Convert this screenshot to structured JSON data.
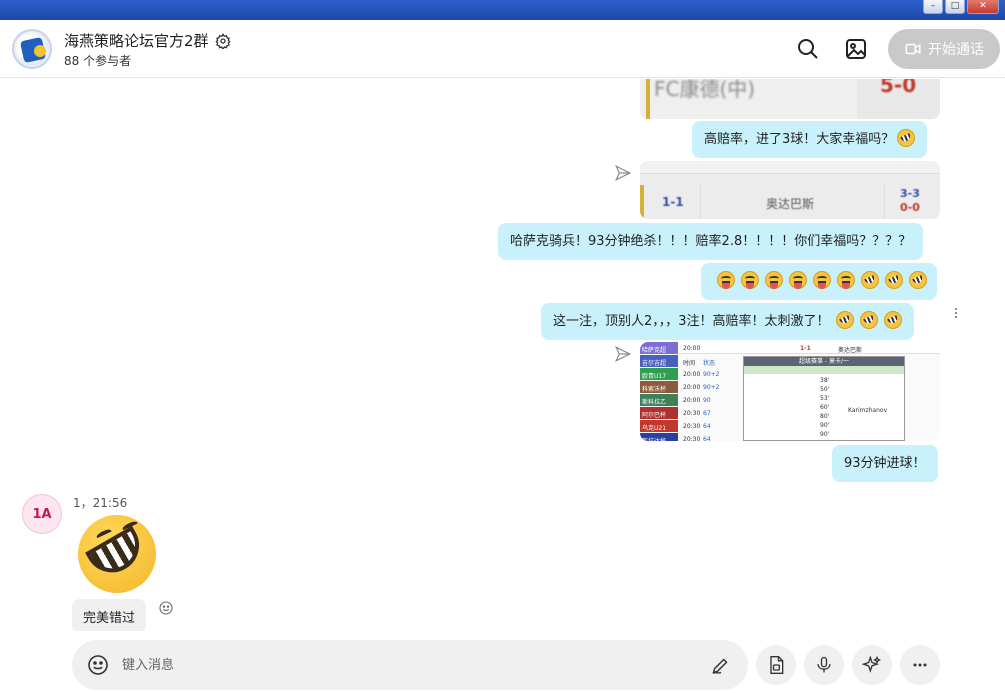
{
  "window": {
    "minimize_label": "–",
    "maximize_label": "□",
    "close_label": "✕"
  },
  "header": {
    "group_name": "海燕策略论坛官方2群",
    "participants": "88 个参与者",
    "call_label": "开始通话"
  },
  "messages": {
    "text1": "高赔率，进了3球！大家幸福吗？",
    "text2": "哈萨克骑兵！93分钟绝杀！！！赔率2.8！！！！你们幸福吗？？？？",
    "text3": "这一注，顶别人2，，，3注！高赔率！太刺激了！",
    "text4": "93分钟进球！",
    "img1_team": "FC康德(中)",
    "img1_score": "5-0",
    "img2_score_left": "1-1",
    "img2_team": "奥达巴斯",
    "img2_score_right_top": "3-3",
    "img2_score_right_bottom": "0-0",
    "img3_header_left": "哈萨克超",
    "img3_header_time": "20:00",
    "img3_header_score": "1-1",
    "img3_header_team": "奥达巴斯",
    "img3_panel_title": "超级赛事 - 莫卡/一",
    "img3_rows": [
      {
        "league": "吉尔吉超",
        "time": "时间",
        "state": "状态"
      },
      {
        "league": "欧青U17",
        "time": "20:00",
        "state": "90+2"
      },
      {
        "league": "科索沃杯",
        "time": "20:00",
        "state": "90+2"
      },
      {
        "league": "斯科拉乙",
        "time": "20:00",
        "state": "90"
      },
      {
        "league": "阿尔巴杯",
        "time": "20:30",
        "state": "67"
      },
      {
        "league": "乌克U21",
        "time": "20:30",
        "state": "64"
      },
      {
        "league": "瓦拉达杯",
        "time": "20:30",
        "state": "64"
      }
    ],
    "img3_minutes": [
      "38'",
      "50'",
      "53'",
      "60'",
      "80'",
      "90'",
      "90'"
    ],
    "img3_player": "Karimzhanov"
  },
  "sender": {
    "avatar_text": "1A",
    "meta": "1，21:56",
    "reply_text": "完美错过"
  },
  "composer": {
    "placeholder": "键入消息"
  },
  "colors": {
    "bubble_mine": "#c8f1fb",
    "bubble_other": "#f0f0f0",
    "titlebar": "#2e5fc9",
    "call_button_disabled": "#c9c9c9"
  },
  "icons": [
    "settings-gear-icon",
    "search-icon",
    "image-gallery-icon",
    "video-call-icon",
    "sent-icon",
    "laughing-emoji",
    "tongue-emoji",
    "smile-icon",
    "handwriting-pen-icon",
    "file-icon",
    "microphone-icon",
    "sparkle-icon",
    "more-icon"
  ]
}
